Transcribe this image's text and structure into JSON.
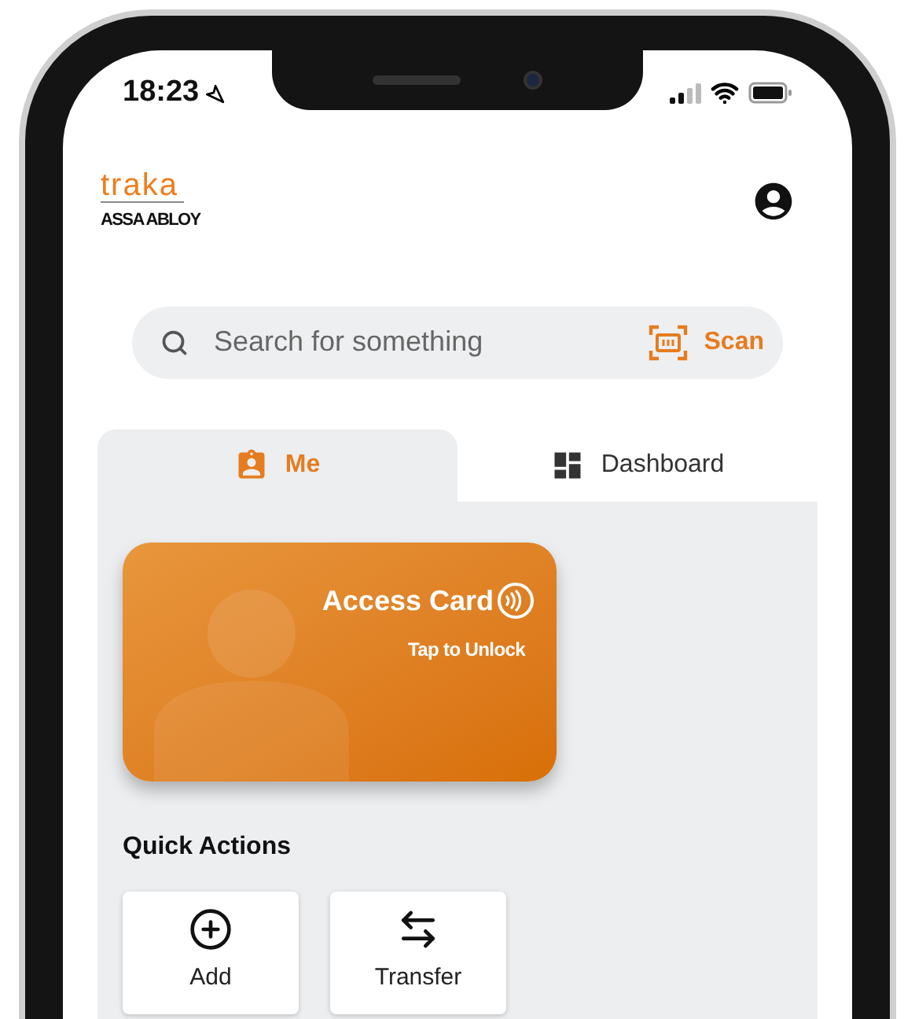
{
  "status_bar": {
    "time": "18:23"
  },
  "header": {
    "logo": "traka",
    "logo_subtitle": "ASSA ABLOY"
  },
  "search": {
    "placeholder": "Search for something",
    "action": "Scan"
  },
  "tabs": [
    {
      "label": "Me",
      "kind": "me",
      "selected": true
    },
    {
      "label": "Dashboard",
      "kind": "dashboard",
      "selected": false
    }
  ],
  "access_card": {
    "title": "Access Card",
    "subtitle": "Tap to Unlock"
  },
  "quick_actions": {
    "title": "Quick Actions",
    "items": [
      {
        "label": "Add",
        "kind": "add"
      },
      {
        "label": "Transfer",
        "kind": "transfer"
      }
    ]
  }
}
